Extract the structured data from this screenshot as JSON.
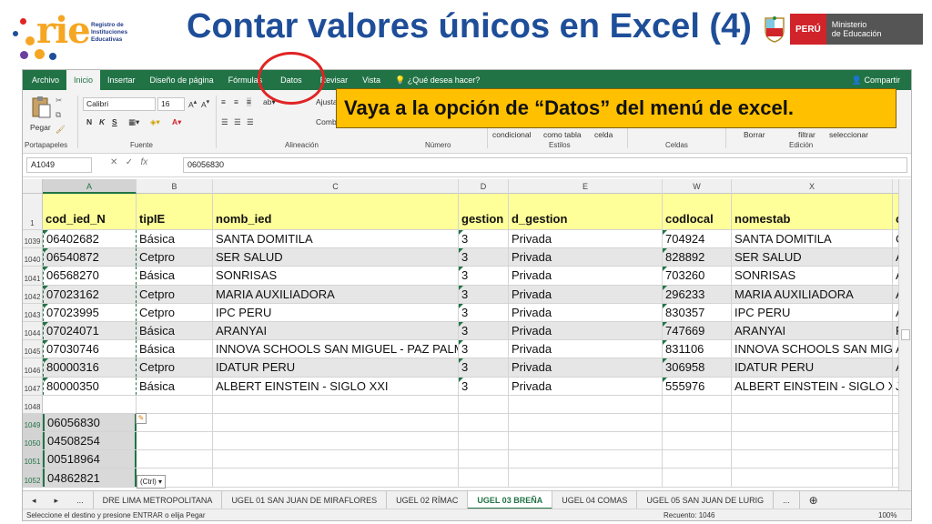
{
  "slide": {
    "title": "Contar valores únicos en Excel (4)",
    "logo_word": "rie",
    "logo_sub": [
      "Registro de",
      "Instituciones",
      "Educativas"
    ],
    "gov_peru": "PERÚ",
    "gov_ministry": [
      "Ministerio",
      "de Educación"
    ]
  },
  "ribbon_tabs": [
    "Archivo",
    "Inicio",
    "Insertar",
    "Diseño de página",
    "Fórmulas",
    "Datos",
    "Revisar",
    "Vista",
    "¿Qué desea hacer?"
  ],
  "ribbon_share": "Compartir",
  "ribbon": {
    "paste": "Pegar",
    "font_name": "Calibri",
    "font_size": "16",
    "bold": "N",
    "italic": "K",
    "underline": "S",
    "wrap_partial": "Ajusta",
    "merge_partial": "Comb",
    "cond_format": "condicional",
    "table_format": "como tabla",
    "cell_style": "celda",
    "filter": "filtrar",
    "select": "seleccionar",
    "clear_partial": "Borrar",
    "groups": {
      "clipboard": "Portapapeles",
      "font": "Fuente",
      "alignment": "Alineación",
      "number": "Número",
      "styles": "Estilos",
      "cells": "Celdas",
      "editing": "Edición"
    }
  },
  "callout": "Vaya a la opción de “Datos” del menú de excel.",
  "formula_bar": {
    "name_box": "A1049",
    "fx": "fx",
    "value": "06056830"
  },
  "columns": [
    "A",
    "B",
    "C",
    "D",
    "E",
    "W",
    "X",
    ""
  ],
  "header_row": {
    "num": "1",
    "cells": [
      "cod_ied_N",
      "tipIE",
      "nomb_ied",
      "gestion",
      "d_gestion",
      "codlocal",
      "nomestab",
      "c"
    ]
  },
  "rows": [
    {
      "num": "1039",
      "cells": [
        "06402682",
        "Básica",
        "SANTA DOMITILA",
        "3",
        "Privada",
        "704924",
        "SANTA DOMITILA",
        "C"
      ]
    },
    {
      "num": "1040",
      "cells": [
        "06540872",
        "Cetpro",
        "SER SALUD",
        "3",
        "Privada",
        "828892",
        "SER SALUD",
        "A"
      ]
    },
    {
      "num": "1041",
      "cells": [
        "06568270",
        "Básica",
        "SONRISAS",
        "3",
        "Privada",
        "703260",
        "SONRISAS",
        "A"
      ]
    },
    {
      "num": "1042",
      "cells": [
        "07023162",
        "Cetpro",
        "MARIA AUXILIADORA",
        "3",
        "Privada",
        "296233",
        "MARIA AUXILIADORA",
        "A"
      ]
    },
    {
      "num": "1043",
      "cells": [
        "07023995",
        "Cetpro",
        "IPC PERU",
        "3",
        "Privada",
        "830357",
        "IPC PERU",
        "A"
      ]
    },
    {
      "num": "1044",
      "cells": [
        "07024071",
        "Básica",
        "ARANYAI",
        "3",
        "Privada",
        "747669",
        "ARANYAI",
        "F"
      ]
    },
    {
      "num": "1045",
      "cells": [
        "07030746",
        "Básica",
        "INNOVA SCHOOLS SAN MIGUEL - PAZ PALM",
        "3",
        "Privada",
        "831106",
        "INNOVA SCHOOLS SAN MIGU",
        "A"
      ]
    },
    {
      "num": "1046",
      "cells": [
        "80000316",
        "Cetpro",
        "IDATUR PERU",
        "3",
        "Privada",
        "306958",
        "IDATUR PERU",
        "A"
      ]
    },
    {
      "num": "1047",
      "cells": [
        "80000350",
        "Básica",
        "ALBERT EINSTEIN - SIGLO XXI",
        "3",
        "Privada",
        "555976",
        "ALBERT EINSTEIN - SIGLO XXI",
        "J"
      ]
    }
  ],
  "empty_row_num": "1048",
  "pasted_rows": [
    {
      "num": "1049",
      "value": "06056830"
    },
    {
      "num": "1050",
      "value": "04508254"
    },
    {
      "num": "1051",
      "value": "00518964"
    },
    {
      "num": "1052",
      "value": "04862821"
    }
  ],
  "paste_ctrl": "(Ctrl) ▾",
  "sheet_tabs": [
    "...",
    "DRE LIMA METROPOLITANA",
    "UGEL 01 SAN JUAN DE MIRAFLORES",
    "UGEL 02 RÍMAC",
    "UGEL 03 BREÑA",
    "UGEL 04 COMAS",
    "UGEL 05 SAN JUAN DE LURIG",
    "..."
  ],
  "active_sheet": "UGEL 03 BREÑA",
  "status": {
    "message": "Seleccione el destino y presione ENTRAR o elija Pegar",
    "count": "Recuento: 1046",
    "zoom": "100%"
  },
  "colors": {
    "excel_green": "#217346",
    "title_blue": "#1f4e99",
    "callout_bg": "#ffc000",
    "header_yellow": "#ffff99",
    "circle_red": "#e02424"
  }
}
